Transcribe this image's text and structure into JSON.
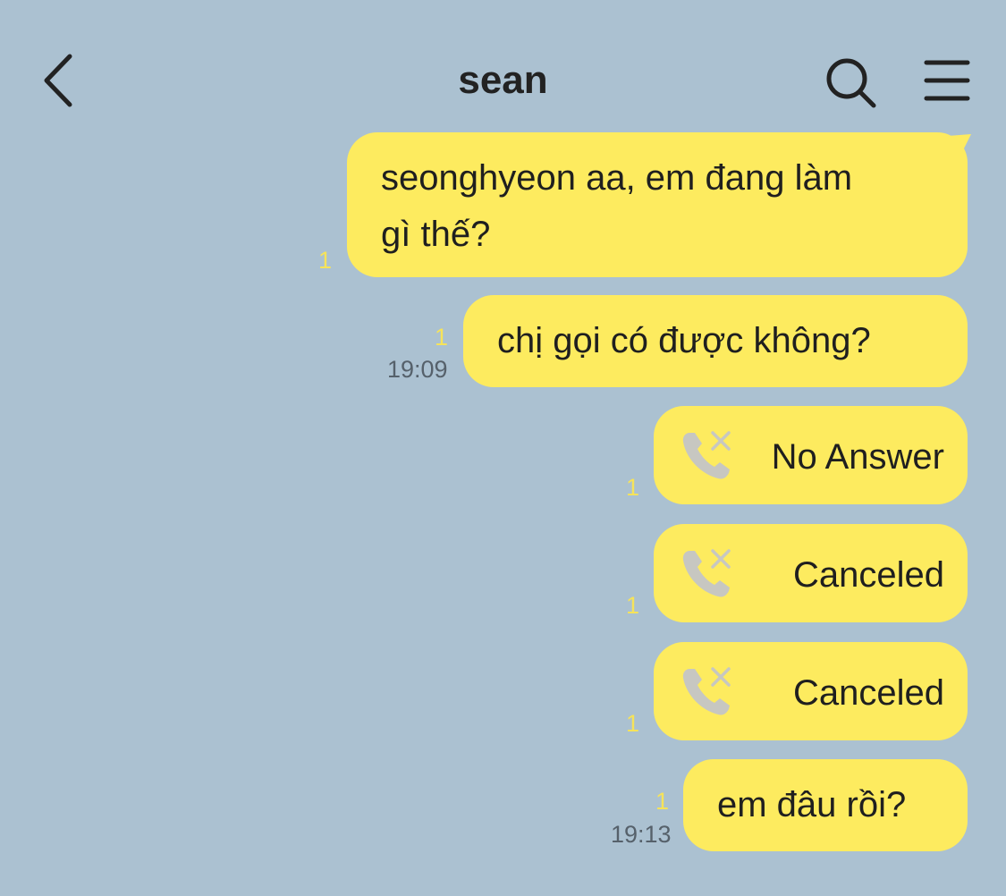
{
  "header": {
    "title": "sean",
    "back_icon": "chevron-left-icon",
    "search_icon": "search-icon",
    "menu_icon": "hamburger-menu-icon"
  },
  "colors": {
    "background": "#abc1d1",
    "bubble": "#fdeb5f",
    "unread_count": "#f6e35a",
    "call_icon": "#c7c7c1"
  },
  "messages": [
    {
      "text": "seonghyeon aa, em đang làm",
      "text2": "gì thế?",
      "read_count": "1",
      "time": ""
    },
    {
      "text": "chị gọi có được không?",
      "read_count": "1",
      "time": "19:09"
    },
    {
      "call_status": "No Answer",
      "icon": "missed-call-icon",
      "read_count": "1"
    },
    {
      "call_status": "Canceled",
      "icon": "missed-call-icon",
      "read_count": "1"
    },
    {
      "call_status": "Canceled",
      "icon": "missed-call-icon",
      "read_count": "1"
    },
    {
      "text": "em đâu rồi?",
      "read_count": "1",
      "time": "19:13"
    }
  ]
}
